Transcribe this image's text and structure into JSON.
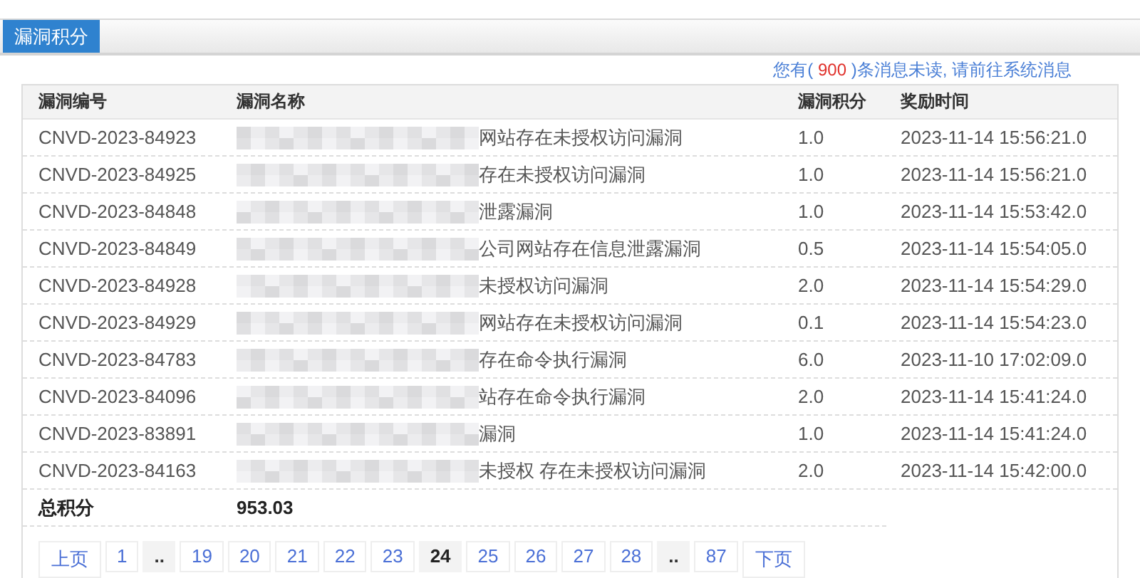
{
  "tab": {
    "label": "漏洞积分",
    "selected": true
  },
  "notice": {
    "prefix": "您有(",
    "count": "900",
    "suffix": ")条消息未读, 请前往系统消息"
  },
  "table": {
    "columns": [
      "漏洞编号",
      "漏洞名称",
      "漏洞积分",
      "奖励时间"
    ],
    "rows": [
      {
        "id": "CNVD-2023-84923",
        "name": "网站存在未授权访问漏洞",
        "score": "1.0",
        "time": "2023-11-14 15:56:21.0"
      },
      {
        "id": "CNVD-2023-84925",
        "name": "存在未授权访问漏洞",
        "score": "1.0",
        "time": "2023-11-14 15:56:21.0"
      },
      {
        "id": "CNVD-2023-84848",
        "name": "泄露漏洞",
        "score": "1.0",
        "time": "2023-11-14 15:53:42.0"
      },
      {
        "id": "CNVD-2023-84849",
        "name": "公司网站存在信息泄露漏洞",
        "score": "0.5",
        "time": "2023-11-14 15:54:05.0"
      },
      {
        "id": "CNVD-2023-84928",
        "name": "未授权访问漏洞",
        "score": "2.0",
        "time": "2023-11-14 15:54:29.0"
      },
      {
        "id": "CNVD-2023-84929",
        "name": "网站存在未授权访问漏洞",
        "score": "0.1",
        "time": "2023-11-14 15:54:23.0"
      },
      {
        "id": "CNVD-2023-84783",
        "name": "存在命令执行漏洞",
        "score": "6.0",
        "time": "2023-11-10 17:02:09.0"
      },
      {
        "id": "CNVD-2023-84096",
        "name": "站存在命令执行漏洞",
        "score": "2.0",
        "time": "2023-11-14 15:41:24.0"
      },
      {
        "id": "CNVD-2023-83891",
        "name": "漏洞",
        "score": "1.0",
        "time": "2023-11-14 15:41:24.0"
      },
      {
        "id": "CNVD-2023-84163",
        "name": "未授权 存在未授权访问漏洞",
        "score": "2.0",
        "time": "2023-11-14 15:42:00.0"
      }
    ],
    "total": {
      "label": "总积分",
      "value": "953.03"
    }
  },
  "pagination": [
    {
      "kind": "prev",
      "label": "上页",
      "selected": false
    },
    {
      "kind": "page",
      "label": "1",
      "selected": false
    },
    {
      "kind": "ellipsis",
      "label": "..",
      "selected": false
    },
    {
      "kind": "page",
      "label": "19",
      "selected": false
    },
    {
      "kind": "page",
      "label": "20",
      "selected": false
    },
    {
      "kind": "page",
      "label": "21",
      "selected": false
    },
    {
      "kind": "page",
      "label": "22",
      "selected": false
    },
    {
      "kind": "page",
      "label": "23",
      "selected": false
    },
    {
      "kind": "page",
      "label": "24",
      "selected": true
    },
    {
      "kind": "page",
      "label": "25",
      "selected": false
    },
    {
      "kind": "page",
      "label": "26",
      "selected": false
    },
    {
      "kind": "page",
      "label": "27",
      "selected": false
    },
    {
      "kind": "page",
      "label": "28",
      "selected": false
    },
    {
      "kind": "ellipsis",
      "label": "..",
      "selected": false
    },
    {
      "kind": "page",
      "label": "87",
      "selected": false
    },
    {
      "kind": "next",
      "label": "下页",
      "selected": false
    }
  ]
}
